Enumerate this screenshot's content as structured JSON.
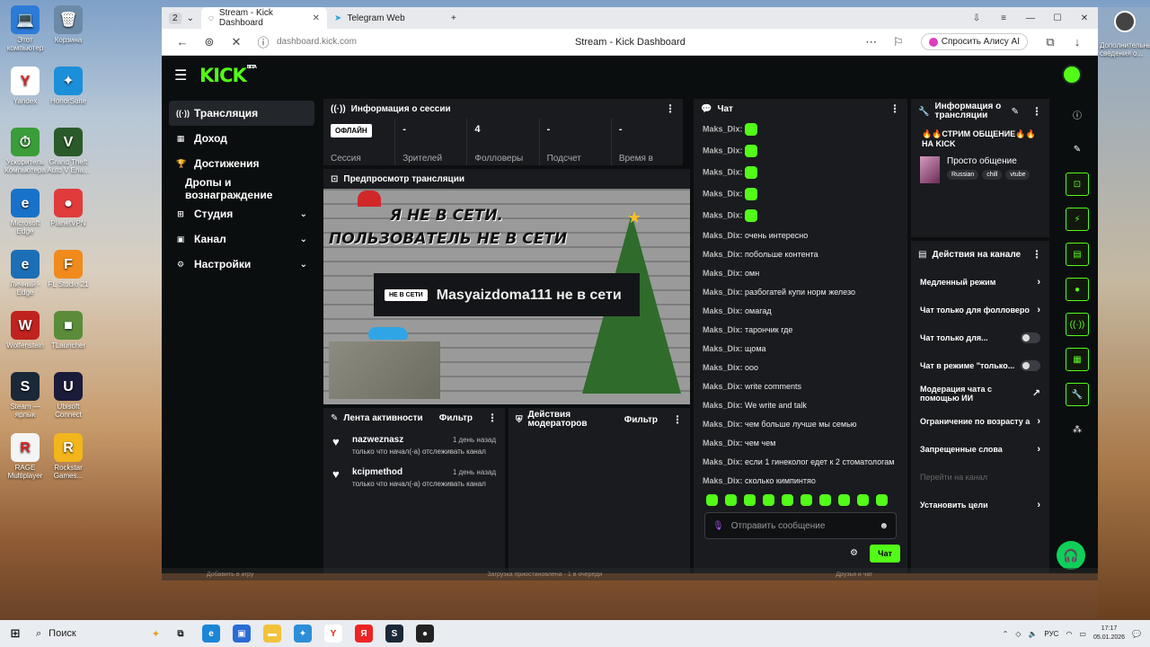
{
  "desktop": {
    "icons": [
      {
        "label": "Этот компьютер",
        "letter": "💻",
        "bg": "#2c7bd8"
      },
      {
        "label": "Корзина",
        "letter": "🗑",
        "bg": "#6c8aa8"
      },
      {
        "label": "Yandex",
        "letter": "Y",
        "bg": "#ffffff"
      },
      {
        "label": "HonorSuite",
        "letter": "✦",
        "bg": "#1b8fd9"
      },
      {
        "label": "Ускоритель Компьютера",
        "letter": "⏱",
        "bg": "#3a9d3a"
      },
      {
        "label": "Grand Theft Auto V Ena...",
        "letter": "V",
        "bg": "#2a5a2a"
      },
      {
        "label": "Microsoft Edge",
        "letter": "e",
        "bg": "#1872c9"
      },
      {
        "label": "PlanetVPN",
        "letter": "●",
        "bg": "#e13b3b"
      },
      {
        "label": "Личный - Edge",
        "letter": "e",
        "bg": "#1c6fb6"
      },
      {
        "label": "FL Studio 21",
        "letter": "F",
        "bg": "#f08a1c"
      },
      {
        "label": "Wolfenstein",
        "letter": "W",
        "bg": "#c0221f"
      },
      {
        "label": "TLauncher",
        "letter": "■",
        "bg": "#5a8c3a"
      },
      {
        "label": "Steam — ярлык",
        "letter": "S",
        "bg": "#1b2838"
      },
      {
        "label": "Ubisoft Connect",
        "letter": "U",
        "bg": "#1b1b3a"
      },
      {
        "label": "RAGE Multiplayer",
        "letter": "R",
        "bg": "#f4f4f4"
      },
      {
        "label": "Rockstar Games...",
        "letter": "R",
        "bg": "#f2b51b"
      }
    ],
    "right_caption": "Дополнительные сведения о..."
  },
  "browser": {
    "tab_count": "2",
    "tabs": [
      {
        "title": "Stream - Kick Dashboard",
        "close": "✕"
      },
      {
        "title": "Telegram Web"
      }
    ],
    "new_tab": "+",
    "url": "dashboard.kick.com",
    "page_title": "Stream - Kick Dashboard",
    "alisa": "Спросить Алису AI"
  },
  "kick": {
    "logo": "KICK",
    "logo_beta": "BETA",
    "sidebar": [
      {
        "label": "Трансляция",
        "icon": "((·))",
        "active": true
      },
      {
        "label": "Доход",
        "icon": "▦"
      },
      {
        "label": "Достижения",
        "icon": "🏆"
      },
      {
        "label": "Дропы и вознаграждение",
        "sub": true
      },
      {
        "label": "Студия",
        "icon": "⊞",
        "chev": "⌄"
      },
      {
        "label": "Канал",
        "icon": "▣",
        "chev": "⌄"
      },
      {
        "label": "Настройки",
        "icon": "⚙",
        "chev": "⌄"
      }
    ],
    "session": {
      "title": "Информация о сессии",
      "status": "ОФЛАЙН",
      "stats": [
        {
          "value": "",
          "label": "Сессия"
        },
        {
          "value": "-",
          "label": "Зрителей"
        },
        {
          "value": "4",
          "label": "Фолловеры"
        },
        {
          "value": "-",
          "label": "Подсчет"
        },
        {
          "value": "-",
          "label": "Время в"
        }
      ]
    },
    "preview": {
      "title": "Предпросмотр трансляции",
      "overlay_line1": "Я НЕ В СЕТИ.",
      "overlay_line2": "ПОЛЬЗОВАТЕЛЬ НЕ В СЕТИ",
      "badge": "НЕ В СЕТИ",
      "message": "Masyaizdoma111 не в сети"
    },
    "activity": {
      "title": "Лента активности",
      "filter": "Фильтр",
      "items": [
        {
          "name": "nazweznasz",
          "time": "1 день назад",
          "desc": "только что начал(-а) отслеживать канал"
        },
        {
          "name": "kcipmethod",
          "time": "1 день назад",
          "desc": "только что начал(-а) отслеживать канал"
        }
      ]
    },
    "mod": {
      "title": "Действия модераторов",
      "filter": "Фильтр"
    },
    "chat": {
      "title": "Чат",
      "messages": [
        {
          "user": "Maks_Dix:",
          "text": "",
          "emote": true
        },
        {
          "user": "Maks_Dix:",
          "text": "",
          "emote": true
        },
        {
          "user": "Maks_Dix:",
          "text": "",
          "emote": true
        },
        {
          "user": "Maks_Dix:",
          "text": "",
          "emote": true
        },
        {
          "user": "Maks_Dix:",
          "text": "",
          "emote": true
        },
        {
          "user": "Maks_Dix:",
          "text": "очень интересно"
        },
        {
          "user": "Maks_Dix:",
          "text": "побольше контента"
        },
        {
          "user": "Maks_Dix:",
          "text": "омн"
        },
        {
          "user": "Maks_Dix:",
          "text": "разбогатей купи норм железо"
        },
        {
          "user": "Maks_Dix:",
          "text": "омагад"
        },
        {
          "user": "Maks_Dix:",
          "text": "тарончик где"
        },
        {
          "user": "Maks_Dix:",
          "text": "щома"
        },
        {
          "user": "Maks_Dix:",
          "text": "ооо"
        },
        {
          "user": "Maks_Dix:",
          "text": "write comments"
        },
        {
          "user": "Maks_Dix:",
          "text": "We write and talk"
        },
        {
          "user": "Maks_Dix:",
          "text": "чем больше лучше мы семью"
        },
        {
          "user": "Maks_Dix:",
          "text": "чем чем"
        },
        {
          "user": "Maks_Dix:",
          "text": "если 1 гинеколог едет к 2 стоматологам"
        },
        {
          "user": "Maks_Dix:",
          "text": "сколько кимпинтяо"
        }
      ],
      "placeholder": "Отправить сообщение",
      "send": "Чат"
    },
    "stream_info": {
      "title": "Информация о трансляции",
      "stream_title": "🔥🔥СТРИМ ОБЩЕНИЕ🔥🔥 НА KICK",
      "category": "Просто общение",
      "tags": [
        "Russian",
        "chill",
        "vtube"
      ]
    },
    "channel_actions": {
      "title": "Действия на канале",
      "rows": [
        {
          "label": "Медленный режим",
          "kind": "chevron"
        },
        {
          "label": "Чат только для фолловеро",
          "kind": "chevron"
        },
        {
          "label": "Чат только для...",
          "kind": "toggle"
        },
        {
          "label": "Чат в режиме \"только...",
          "kind": "toggle"
        },
        {
          "label": "Модерация чата с помощью ИИ",
          "kind": "external"
        },
        {
          "label": "Ограничение по возрасту а",
          "kind": "chevron"
        },
        {
          "label": "Запрещенные слова",
          "kind": "chevron"
        },
        {
          "label": "Перейти на канал",
          "kind": "dim"
        },
        {
          "label": "Установить цели",
          "kind": "chevron"
        }
      ]
    }
  },
  "under_strip": {
    "left": "Добавить в игру",
    "mid": "Загрузка приостановлена · 1 в очереди",
    "right": "Друзья и чат"
  },
  "taskbar": {
    "search": "Поиск",
    "lang": "РУС",
    "time": "17:17",
    "date": "05.01.2026"
  }
}
